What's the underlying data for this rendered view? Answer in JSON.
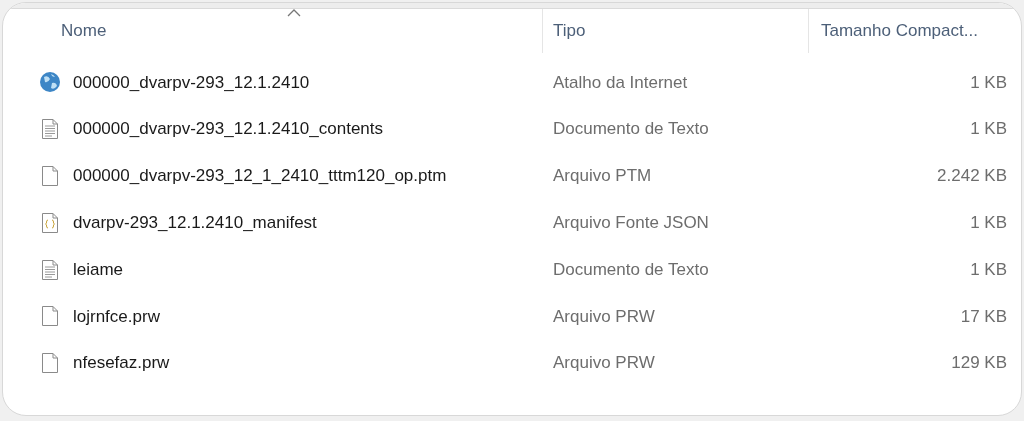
{
  "columns": [
    {
      "label": "Nome",
      "sorted": true
    },
    {
      "label": "Tipo",
      "sorted": false
    },
    {
      "label": "Tamanho Compact...",
      "sorted": false
    }
  ],
  "rows": [
    {
      "kind": "internet",
      "name": "000000_dvarpv-293_12.1.2410",
      "type": "Atalho da Internet",
      "size": "1 KB"
    },
    {
      "kind": "text",
      "name": "000000_dvarpv-293_12.1.2410_contents",
      "type": "Documento de Texto",
      "size": "1 KB"
    },
    {
      "kind": "blank",
      "name": "000000_dvarpv-293_12_1_2410_tttm120_op.ptm",
      "type": "Arquivo PTM",
      "size": "2.242 KB"
    },
    {
      "kind": "json",
      "name": "dvarpv-293_12.1.2410_manifest",
      "type": "Arquivo Fonte JSON",
      "size": "1 KB"
    },
    {
      "kind": "text",
      "name": "leiame",
      "type": "Documento de Texto",
      "size": "1 KB"
    },
    {
      "kind": "blank",
      "name": "lojrnfce.prw",
      "type": "Arquivo PRW",
      "size": "17 KB"
    },
    {
      "kind": "blank",
      "name": "nfesefaz.prw",
      "type": "Arquivo PRW",
      "size": "129 KB"
    }
  ]
}
